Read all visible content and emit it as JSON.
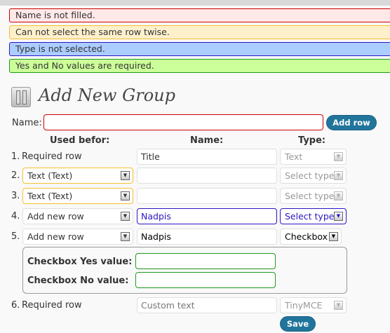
{
  "alerts": [
    {
      "text": "Name is not filled.",
      "bg": "#ffe8e8",
      "border": "#cc0000"
    },
    {
      "text": "Can not select the same row twise.",
      "bg": "#fff0cc",
      "border": "#f5c02e"
    },
    {
      "text": "Type is not selected.",
      "bg": "#abcdff",
      "border": "#2b16c4"
    },
    {
      "text": "Yes and No values are required.",
      "bg": "#ccff99",
      "border": "#1f9a1f"
    }
  ],
  "title": "Add New Group",
  "name_label": "Name:",
  "name_value": "",
  "add_row": "Add row",
  "headers": {
    "used": "Used befor:",
    "name": "Name:",
    "type": "Type:"
  },
  "rows": [
    {
      "num": "1.",
      "used": "Required row",
      "name": "Title",
      "type": "Text"
    },
    {
      "num": "2.",
      "used": "Text (Text)",
      "name": "",
      "type": "Select type"
    },
    {
      "num": "3.",
      "used": "Text (Text)",
      "name": "",
      "type": "Select type"
    },
    {
      "num": "4.",
      "used": "Add new row",
      "name": "Nadpis",
      "type": "Select type"
    },
    {
      "num": "5.",
      "used": "Add new row",
      "name": "Nadpis",
      "type": "Checkbox"
    },
    {
      "num": "6.",
      "used": "Required row",
      "name": "Custom text",
      "type": "TinyMCE"
    }
  ],
  "checkbox": {
    "yes_label": "Checkbox Yes value:",
    "no_label": "Checkbox No value:",
    "yes_value": "",
    "no_value": ""
  },
  "save": "Save"
}
